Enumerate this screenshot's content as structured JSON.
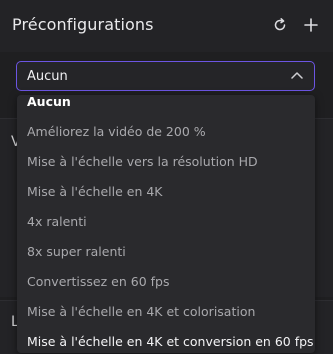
{
  "header": {
    "title": "Préconfigurations"
  },
  "select": {
    "value": "Aucun"
  },
  "background": {
    "section1_letter": "V",
    "section2_letter": "L"
  },
  "dropdown": {
    "options": [
      "Aucun",
      "Améliorez la vidéo de 200 %",
      "Mise à l'échelle vers la résolution HD",
      "Mise à l'échelle en 4K",
      "4x ralenti",
      "8x super ralenti",
      "Convertissez en 60 fps",
      "Mise à l'échelle en 4K et colorisation",
      "Mise à l'échelle en 4K et conversion en 60 fps"
    ],
    "selected_index": 0
  },
  "colors": {
    "accent": "#6c55e3",
    "background": "#1f1f21",
    "dropdown_bg": "#2a2a2d"
  }
}
